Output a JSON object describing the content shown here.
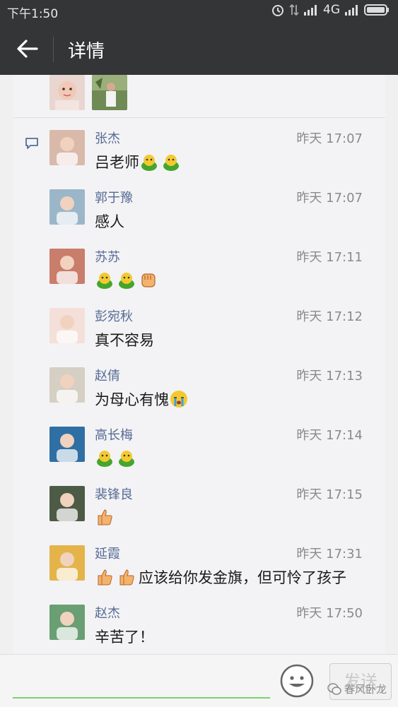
{
  "status_bar": {
    "time": "下午1:50",
    "network": "4G"
  },
  "header": {
    "title": "详情"
  },
  "comments": [
    {
      "name": "张杰",
      "time": "昨天 17:07",
      "text": "吕老师",
      "emojis": [
        "face",
        "face"
      ],
      "emojis_before": []
    },
    {
      "name": "郭于豫",
      "time": "昨天 17:07",
      "text": "感人",
      "emojis": [],
      "emojis_before": []
    },
    {
      "name": "苏苏",
      "time": "昨天 17:11",
      "text": "",
      "emojis": [
        "face",
        "face",
        "fist"
      ],
      "emojis_before": []
    },
    {
      "name": "彭宛秋",
      "time": "昨天 17:12",
      "text": "真不容易",
      "emojis": [],
      "emojis_before": []
    },
    {
      "name": "赵倩",
      "time": "昨天 17:13",
      "text": "为母心有愧",
      "emojis": [
        "cry"
      ],
      "emojis_before": []
    },
    {
      "name": "高长梅",
      "time": "昨天 17:14",
      "text": "",
      "emojis": [
        "face",
        "face"
      ],
      "emojis_before": []
    },
    {
      "name": "裴锋良",
      "time": "昨天 17:15",
      "text": "",
      "emojis": [
        "thumb"
      ],
      "emojis_before": []
    },
    {
      "name": "延霞",
      "time": "昨天 17:31",
      "text": "应该给你发金旗，但可怜了孩子",
      "emojis": [],
      "emojis_before": [
        "thumb",
        "thumb"
      ]
    },
    {
      "name": "赵杰",
      "time": "昨天 17:50",
      "text": "辛苦了！",
      "emojis": [],
      "emojis_before": []
    }
  ],
  "input": {
    "send_label": "发送"
  },
  "watermark": "春风卧龙",
  "colors": {
    "bar": "#333537",
    "name": "#576b95",
    "accent": "#7bd16e"
  }
}
